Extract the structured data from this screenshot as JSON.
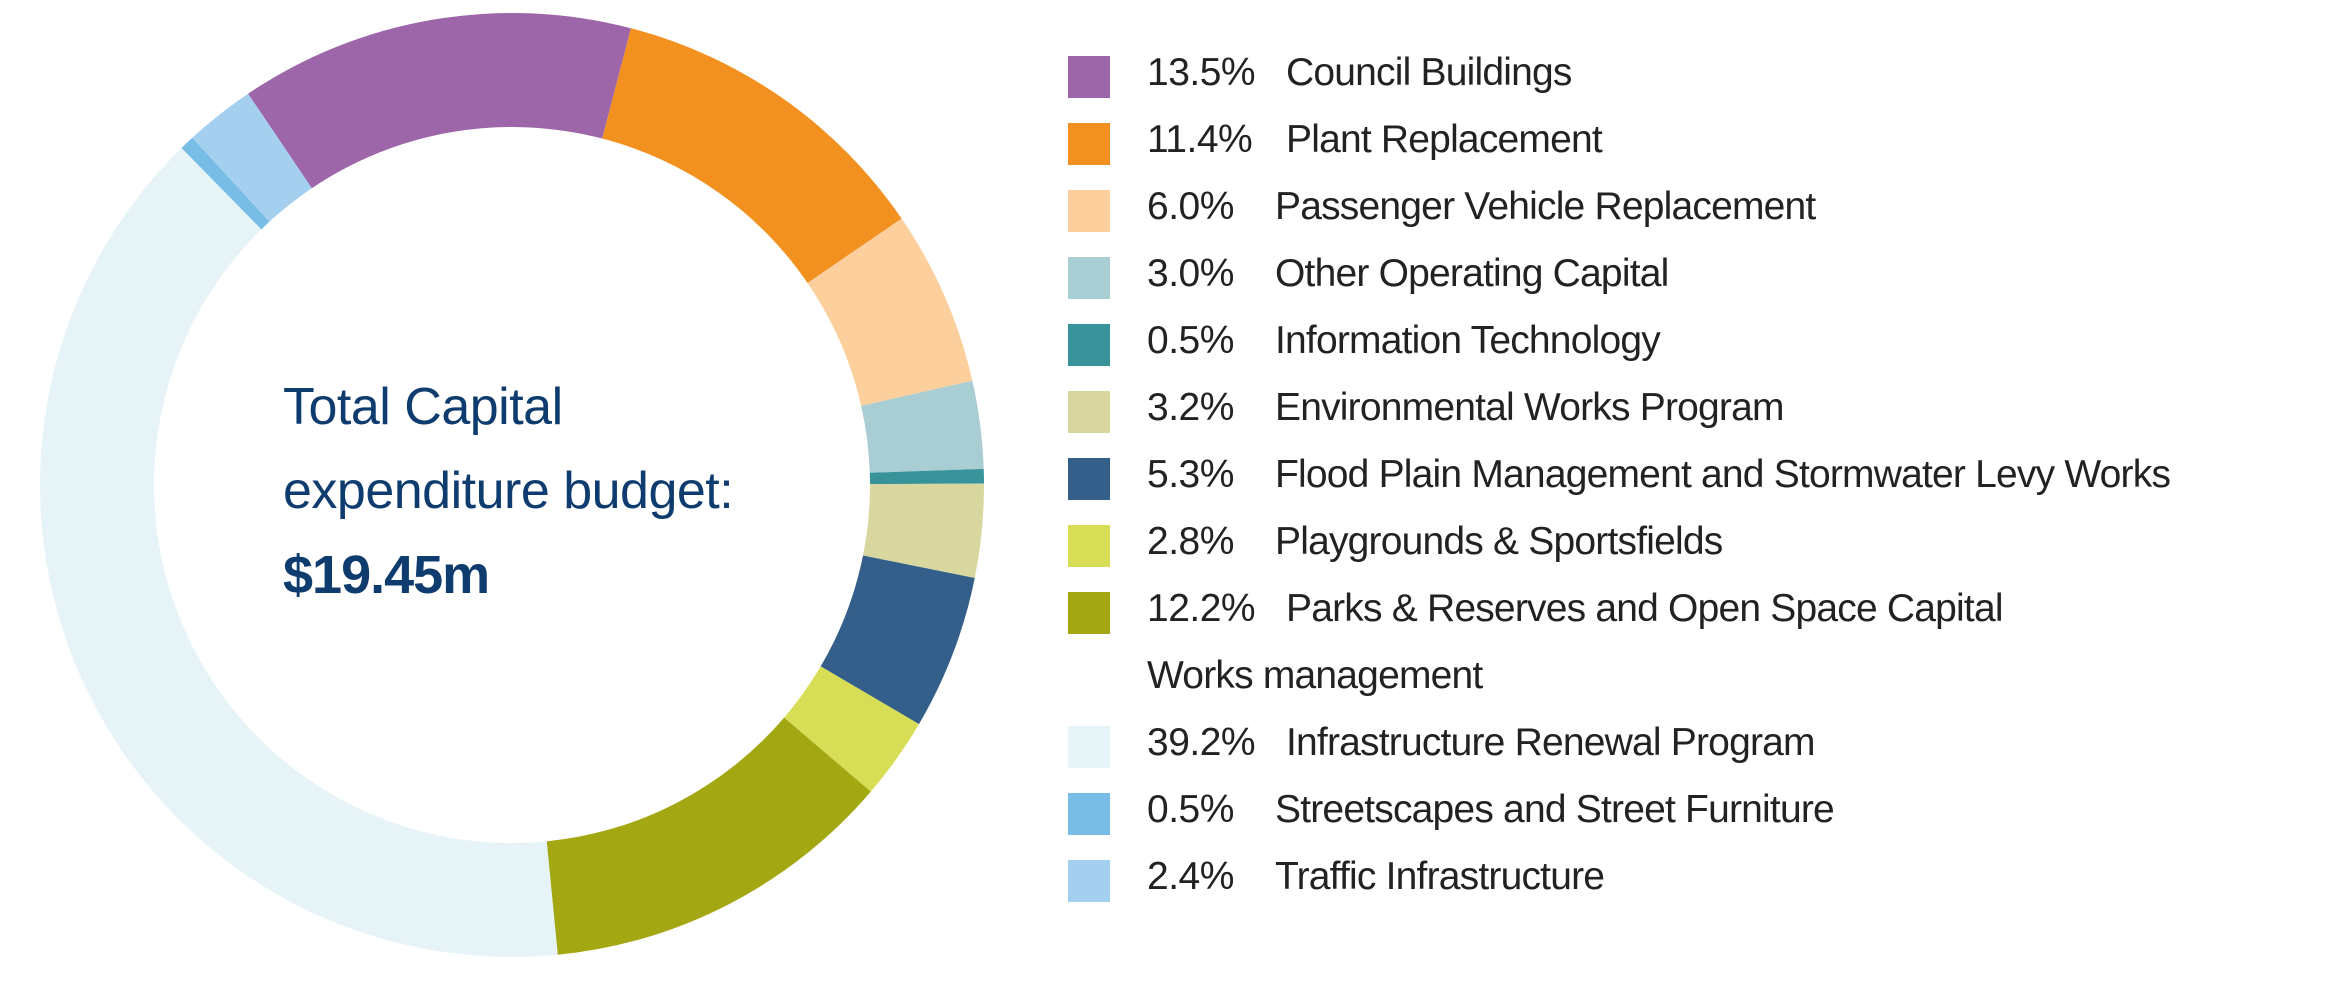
{
  "chart_data": {
    "type": "pie",
    "variant": "donut",
    "title": "",
    "center_label": {
      "line1": "Total Capital",
      "line2": "expenditure budget:",
      "value": "$19.45m"
    },
    "start_angle_deg": -34,
    "direction": "clockwise",
    "slices": [
      {
        "pct_label": "13.5%",
        "value": 13.5,
        "label": "Council Buildings",
        "color": "#9d66a9"
      },
      {
        "pct_label": "11.4%",
        "value": 11.4,
        "label": "Plant Replacement",
        "color": "#f39120"
      },
      {
        "pct_label": "6.0%",
        "value": 6.0,
        "label": "Passenger Vehicle Replacement",
        "color": "#fccf9d"
      },
      {
        "pct_label": "3.0%",
        "value": 3.0,
        "label": "Other Operating Capital",
        "color": "#a8cdd3"
      },
      {
        "pct_label": "0.5%",
        "value": 0.5,
        "label": "Information Technology",
        "color": "#37929a"
      },
      {
        "pct_label": "3.2%",
        "value": 3.2,
        "label": "Environmental Works Program",
        "color": "#d8d79f"
      },
      {
        "pct_label": "5.3%",
        "value": 5.3,
        "label": "Flood Plain Management and Stormwater Levy Works",
        "color": "#335f8a"
      },
      {
        "pct_label": "2.8%",
        "value": 2.8,
        "label": "Playgrounds & Sportsfields",
        "color": "#d8dd56"
      },
      {
        "pct_label": "12.2%",
        "value": 12.2,
        "label": "Parks & Reserves and Open Space Capital",
        "label_cont": "Works management",
        "color": "#a3a712"
      },
      {
        "pct_label": "39.2%",
        "value": 39.2,
        "label": "Infrastructure Renewal Program",
        "color": "#e6f4f8"
      },
      {
        "pct_label": "0.5%",
        "value": 0.5,
        "label": "Streetscapes and Street Furniture",
        "color": "#78bde6"
      },
      {
        "pct_label": "2.4%",
        "value": 2.4,
        "label": "Traffic Infrastructure",
        "color": "#a4cfee"
      }
    ],
    "legend_position": "right"
  }
}
